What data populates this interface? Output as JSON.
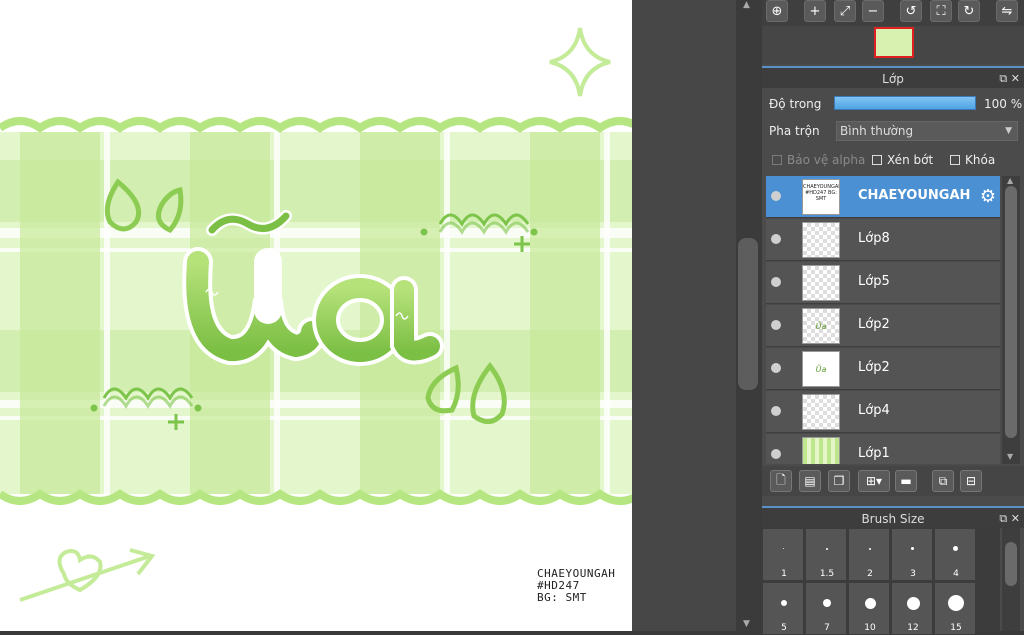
{
  "canvas": {
    "artwork_title": "Ũa",
    "credit_lines": [
      "CHAEYOUNGAH",
      "#HD247",
      "BG: SMT"
    ],
    "colors": {
      "green_light": "#d4f2a8",
      "green_mid": "#a8e070",
      "green_dark": "#6fb83a"
    }
  },
  "toolbar": {
    "icons": [
      "zoom-fit-icon",
      "zoom-in-icon",
      "fit-screen-icon",
      "zoom-out-icon",
      "rotate-left-icon",
      "fullscreen-icon",
      "rotate-right-icon",
      "flip-icon"
    ]
  },
  "layer_panel": {
    "title": "Lớp",
    "opacity_label": "Độ trong",
    "opacity_value": "100 %",
    "opacity_fraction": 1.0,
    "blend_label": "Pha trộn",
    "blend_value": "Bình thường",
    "protect_alpha_label": "Bảo vệ alpha",
    "clipping_label": "Xén bớt",
    "lock_label": "Khóa",
    "layers": [
      {
        "name": "CHAEYOUNGAH",
        "selected": true,
        "thumb": "text",
        "thumb_text": "CHAEYOUNGAH #HD247 BG: SMT"
      },
      {
        "name": "Lớp8",
        "selected": false,
        "thumb": "empty"
      },
      {
        "name": "Lớp5",
        "selected": false,
        "thumb": "empty"
      },
      {
        "name": "Lớp2",
        "selected": false,
        "thumb": "art",
        "thumb_text": "Ũa"
      },
      {
        "name": "Lớp2",
        "selected": false,
        "thumb": "art",
        "thumb_text": "Ũa"
      },
      {
        "name": "Lớp4",
        "selected": false,
        "thumb": "empty"
      },
      {
        "name": "Lớp1",
        "selected": false,
        "thumb": "plaid"
      }
    ]
  },
  "brush_panel": {
    "title": "Brush Size",
    "sizes": [
      "1",
      "1.5",
      "2",
      "3",
      "4",
      "5",
      "7",
      "10",
      "12",
      "15"
    ]
  }
}
